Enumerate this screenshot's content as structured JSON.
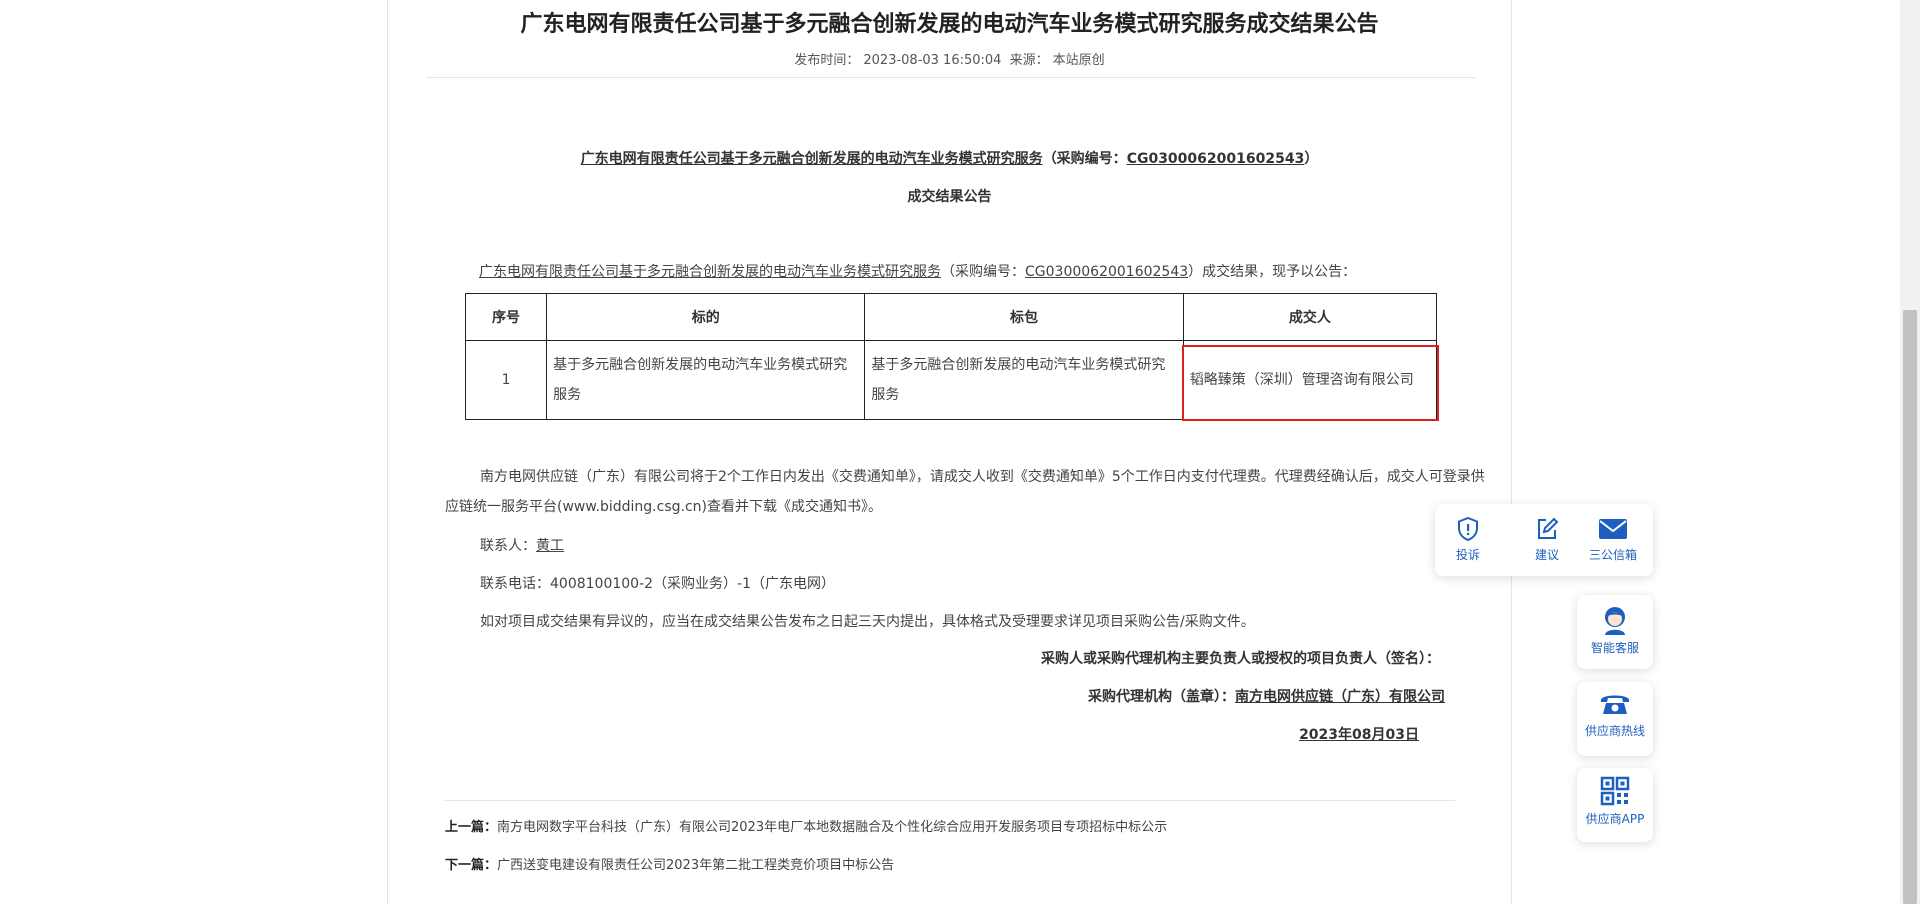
{
  "article": {
    "title": "广东电网有限责任公司基于多元融合创新发展的电动汽车业务模式研究服务成交结果公告",
    "meta_label_time": "发布时间：",
    "meta_time": "2023-08-03 16:50:04",
    "meta_label_source": "来源：",
    "meta_source": "本站原创"
  },
  "heading": {
    "project_name": "广东电网有限责任公司基于多元融合创新发展的电动汽车业务模式研究服务",
    "code_prefix": "（采购编号：",
    "code": "CG0300062001602543",
    "code_suffix": "）",
    "sub": "成交结果公告"
  },
  "intro": {
    "project_name": "广东电网有限责任公司基于多元融合创新发展的电动汽车业务模式研究服务",
    "code_prefix": "（采购编号：",
    "code": "CG0300062001602543",
    "suffix": "）成交结果，现予以公告："
  },
  "table": {
    "headers": [
      "序号",
      "标的",
      "标包",
      "成交人"
    ],
    "rows": [
      [
        "1",
        "基于多元融合创新发展的电动汽车业务模式研究服务",
        "基于多元融合创新发展的电动汽车业务模式研究服务",
        "韬略臻策（深圳）管理咨询有限公司"
      ]
    ]
  },
  "body": {
    "paragraph1": "南方电网供应链（广东）有限公司将于2个工作日内发出《交费通知单》，请成交人收到《交费通知单》5个工作日内支付代理费。代理费经确认后，成交人可登录供应链统一服务平台(www.bidding.csg.cn)查看并下载《成交通知书》。",
    "contact_label": "联系人：",
    "contact_name": "黄工",
    "phone": "联系电话：4008100100-2（采购业务）-1（广东电网）",
    "objection": "如对项目成交结果有异议的，应当在成交结果公告发布之日起三天内提出，具体格式及受理要求详见项目采购公告/采购文件。"
  },
  "signature": {
    "line1": "采购人或采购代理机构主要负责人或授权的项目负责人（签名）：",
    "agency_label": "采购代理机构（盖章）：",
    "agency_name": "南方电网供应链（广东）有限公司",
    "date": "2023年08月03日"
  },
  "nav": {
    "prev_label": "上一篇：",
    "prev_title": "南方电网数字平台科技（广东）有限公司2023年电厂本地数据融合及个性化综合应用开发服务项目专项招标中标公示",
    "next_label": "下一篇：",
    "next_title": "广西送变电建设有限责任公司2023年第二批工程类竞价项目中标公告"
  },
  "floating": {
    "complaint": "投诉",
    "suggestion": "建议",
    "mailbox": "三公信箱",
    "service": "智能客服",
    "hotline": "供应商热线",
    "app": "供应商APP"
  },
  "colors": {
    "accent": "#1d5fbf",
    "highlight_box": "#e02020"
  }
}
